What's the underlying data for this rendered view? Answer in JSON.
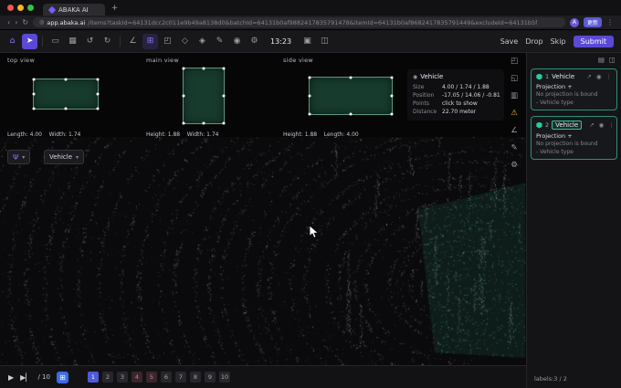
{
  "browser": {
    "tab_title": "ABAKA AI",
    "new_tab": "+",
    "url_domain": "app.abaka.ai",
    "url_params": "/items?taskId=64131dcc2c011e9b49a8138d0&batchId=64131b0af9882417835791478&itemId=64131b0af8682417835791449&excludeId=64131b5f",
    "update_badge": "更新",
    "avatar_initial": "A"
  },
  "icons": {
    "back": "‹",
    "forward": "›",
    "reload": "↻",
    "info": "◎",
    "more": "⋮",
    "home": "⌂",
    "cursor": "➤",
    "rect": "▭",
    "quad": "▦",
    "undo": "↺",
    "redo": "↻",
    "angle": "∠",
    "grid": "⊞",
    "cube": "◰",
    "polygon": "◇",
    "tag": "◈",
    "pencil": "✎",
    "eye": "◉",
    "gear": "⚙",
    "panel": "▣",
    "split": "◫",
    "strip_cube": "◰",
    "strip_layers": "◱",
    "strip_rows": "▥",
    "strip_warning": "⚠",
    "strip_angle": "∠",
    "strip_pencil": "✎",
    "strip_gear": "⚙",
    "collapse": "▤",
    "columns": "◫",
    "speaker": "◉",
    "chevron": "▾",
    "psi": "Ψ",
    "link": "↗",
    "eye_small": "◉",
    "more_v": "⋮",
    "play": "▶",
    "step": "▶▏",
    "grid_button": "⊞"
  },
  "toolbar": {
    "time": "13:23",
    "save": "Save",
    "drop": "Drop",
    "skip": "Skip",
    "submit": "Submit"
  },
  "views": {
    "top": {
      "label": "top view",
      "dims": "Length: 4.00    Width: 1.74"
    },
    "main": {
      "label": "main view",
      "dims": "Height: 1.88    Width: 1.74"
    },
    "side": {
      "label": "side view",
      "dims": "Height: 1.88    Length: 4.00"
    }
  },
  "info_panel": {
    "title": "Vehicle",
    "rows": [
      {
        "label": "Size",
        "value": "4.00  /  1.74  /  1.88"
      },
      {
        "label": "Position",
        "value": "-17.05  /  14.06  /  -0.81"
      },
      {
        "label": "Points",
        "value": "click to show"
      },
      {
        "label": "Distance",
        "value": "22.70 meter"
      }
    ]
  },
  "class_selector": {
    "value": "Vehicle"
  },
  "annotations": [
    {
      "index": "1",
      "label": "Vehicle",
      "projection": "Projection +",
      "status": "No projection is bound",
      "attr": "- Vehicle type"
    },
    {
      "index": "2",
      "label": "Vehicle",
      "projection": "Projection +",
      "status": "No projection is bound",
      "attr": "- Vehicle type"
    }
  ],
  "footer": {
    "total": "/ 10",
    "pages": [
      "1",
      "2",
      "3",
      "4",
      "5",
      "6",
      "7",
      "8",
      "9",
      "10"
    ],
    "labels_count": "labels:3 / 2"
  }
}
